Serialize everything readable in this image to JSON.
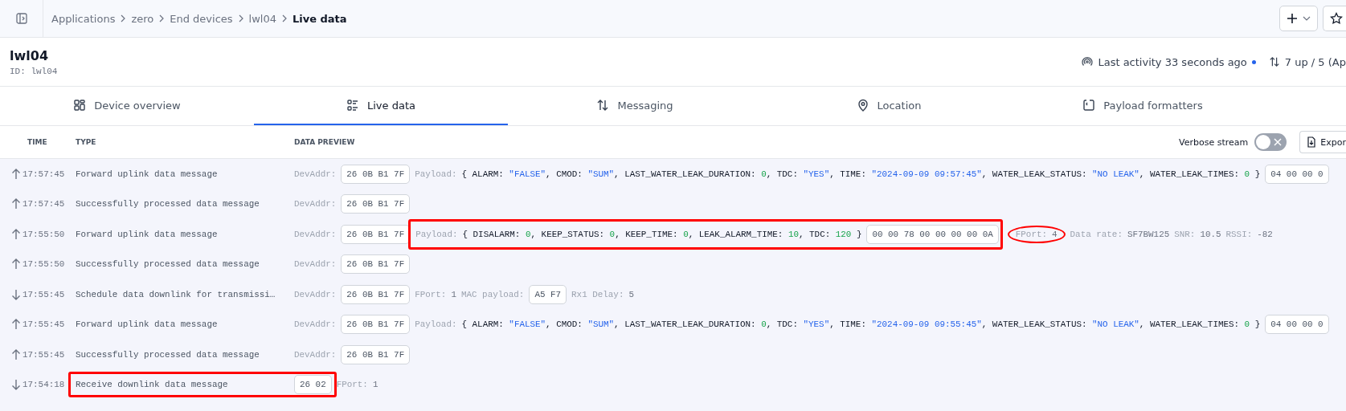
{
  "breadcrumb": {
    "items": [
      "Applications",
      "zero",
      "End devices",
      "lwl04"
    ],
    "current": "Live data"
  },
  "device": {
    "name": "lwl04",
    "id_label": "ID:",
    "id": "lwl04",
    "activity": "Last activity 33 seconds ago",
    "traffic": "7 up / 5 (Ap"
  },
  "tabs": [
    {
      "label": "Device overview",
      "kind": "overview",
      "selected": false
    },
    {
      "label": "Live data",
      "kind": "live",
      "selected": true
    },
    {
      "label": "Messaging",
      "kind": "messaging",
      "selected": false
    },
    {
      "label": "Location",
      "kind": "location",
      "selected": false
    },
    {
      "label": "Payload formatters",
      "kind": "formatters",
      "selected": false
    }
  ],
  "table": {
    "columns": [
      "TIME",
      "TYPE",
      "DATA PREVIEW"
    ],
    "verbose_stream": {
      "label": "Verbose stream",
      "on": false
    },
    "export_label": "Expor",
    "rows": [
      {
        "kind": "up",
        "time": "17:57:45",
        "type": "Forward uplink data message",
        "addr_label": "DevAddr:",
        "addr": "26 0B B1 7F",
        "payload": {
          "label": "Payload:",
          "open": "{",
          "close": "}",
          "fields": [
            {
              "key": "ALARM:",
              "value": "\"FALSE\"",
              "kind": "string",
              "after": ","
            },
            {
              "key": "CMOD:",
              "value": "\"SUM\"",
              "kind": "string",
              "after": ","
            },
            {
              "key": "LAST_WATER_LEAK_DURATION:",
              "value": "0",
              "kind": "number",
              "after": ","
            },
            {
              "key": "TDC:",
              "value": "\"YES\"",
              "kind": "string",
              "after": ","
            },
            {
              "key": "TIME:",
              "value": "\"2024-09-09 09:57:45\"",
              "kind": "string",
              "after": ","
            },
            {
              "key": "WATER_LEAK_STATUS:",
              "value": "\"NO LEAK\"",
              "kind": "string",
              "after": ","
            },
            {
              "key": "WATER_LEAK_TIMES:",
              "value": "0",
              "kind": "number"
            }
          ],
          "hex": "04 00 00 0"
        }
      },
      {
        "kind": "up",
        "time": "17:57:45",
        "type": "Successfully processed data message",
        "addr_label": "DevAddr:",
        "addr": "26 0B B1 7F"
      },
      {
        "kind": "up",
        "time": "17:55:50",
        "type": "Forward uplink data message",
        "addr_label": "DevAddr:",
        "addr": "26 0B B1 7F",
        "payload": {
          "highlighted": true,
          "label": "Payload:",
          "open": "{",
          "close": "}",
          "fields": [
            {
              "key": "DISALARM:",
              "value": "0",
              "kind": "number",
              "after": ","
            },
            {
              "key": "KEEP_STATUS:",
              "value": "0",
              "kind": "number",
              "after": ","
            },
            {
              "key": "KEEP_TIME:",
              "value": "0",
              "kind": "number",
              "after": ","
            },
            {
              "key": "LEAK_ALARM_TIME:",
              "value": "10",
              "kind": "number",
              "after": ","
            },
            {
              "key": "TDC:",
              "value": "120",
              "kind": "number"
            }
          ],
          "hex": "00 00 78 00 00 00 00 0A"
        },
        "metadata": [
          {
            "kind": "text",
            "label": "FPort:",
            "value": "4",
            "circled": true
          },
          {
            "kind": "text",
            "label": "Data rate:",
            "value": "SF7BW125",
            "circled": false
          },
          {
            "kind": "text",
            "label": "SNR:",
            "value": "10.5",
            "circled": false
          },
          {
            "kind": "text",
            "label": "RSSI:",
            "value": "-82",
            "circled": false
          }
        ]
      },
      {
        "kind": "up",
        "time": "17:55:50",
        "type": "Successfully processed data message",
        "addr_label": "DevAddr:",
        "addr": "26 0B B1 7F"
      },
      {
        "kind": "down",
        "time": "17:55:45",
        "type": "Schedule data downlink for transmissi…",
        "addr_label": "DevAddr:",
        "addr": "26 0B B1 7F",
        "extras": [
          {
            "kind": "text",
            "label": "FPort:",
            "value": "1",
            "circled": false
          },
          {
            "kind": "chip",
            "label": "MAC payload:",
            "value": "A5 F7",
            "circled": false
          },
          {
            "kind": "text",
            "label": "Rx1 Delay:",
            "value": "5",
            "circled": false
          }
        ]
      },
      {
        "kind": "up",
        "time": "17:55:45",
        "type": "Forward uplink data message",
        "addr_label": "DevAddr:",
        "addr": "26 0B B1 7F",
        "payload": {
          "label": "Payload:",
          "open": "{",
          "close": "}",
          "fields": [
            {
              "key": "ALARM:",
              "value": "\"FALSE\"",
              "kind": "string",
              "after": ","
            },
            {
              "key": "CMOD:",
              "value": "\"SUM\"",
              "kind": "string",
              "after": ","
            },
            {
              "key": "LAST_WATER_LEAK_DURATION:",
              "value": "0",
              "kind": "number",
              "after": ","
            },
            {
              "key": "TDC:",
              "value": "\"YES\"",
              "kind": "string",
              "after": ","
            },
            {
              "key": "TIME:",
              "value": "\"2024-09-09 09:55:45\"",
              "kind": "string",
              "after": ","
            },
            {
              "key": "WATER_LEAK_STATUS:",
              "value": "\"NO LEAK\"",
              "kind": "string",
              "after": ","
            },
            {
              "key": "WATER_LEAK_TIMES:",
              "value": "0",
              "kind": "number"
            }
          ],
          "hex": "04 00 00 0"
        }
      },
      {
        "kind": "up",
        "time": "17:55:45",
        "type": "Successfully processed data message",
        "addr_label": "DevAddr:",
        "addr": "26 0B B1 7F"
      },
      {
        "kind": "down",
        "type_highlighted": true,
        "time": "17:54:18",
        "type": "Receive downlink data message",
        "bytes": "26 02",
        "extras": [
          {
            "kind": "text",
            "label": "FPort:",
            "value": "1",
            "circled": false
          }
        ]
      }
    ]
  }
}
